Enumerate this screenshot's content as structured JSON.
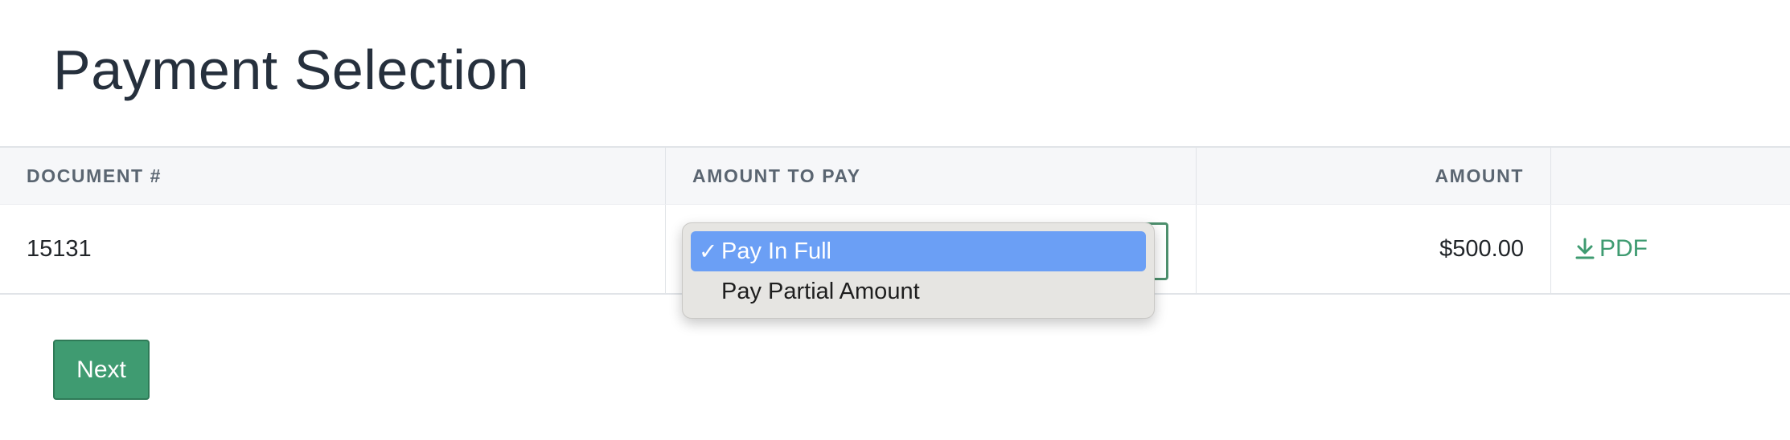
{
  "page": {
    "title": "Payment Selection"
  },
  "table": {
    "headers": {
      "document": "DOCUMENT #",
      "amount_to_pay": "AMOUNT TO PAY",
      "amount": "AMOUNT",
      "actions": ""
    },
    "rows": [
      {
        "document": "15131",
        "amount_to_pay": "Pay In Full",
        "amount": "$500.00",
        "download_label": "PDF"
      }
    ]
  },
  "dropdown": {
    "options": [
      {
        "label": "Pay In Full",
        "selected": true,
        "check": "✓"
      },
      {
        "label": "Pay Partial Amount",
        "selected": false
      }
    ]
  },
  "actions": {
    "next_label": "Next"
  },
  "colors": {
    "accent": "#3f9b71",
    "selected_option": "#6b9ff5",
    "header_bg": "#f6f7f9"
  },
  "icons": {
    "download": "download-icon"
  }
}
